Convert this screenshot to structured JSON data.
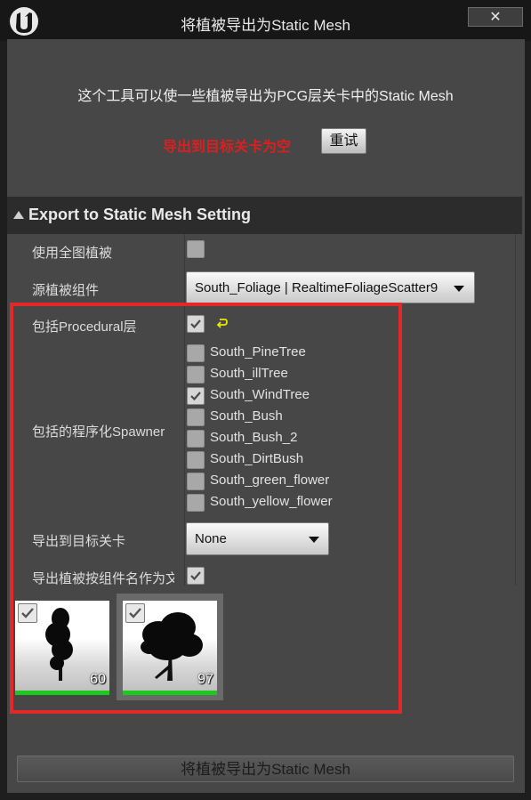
{
  "window": {
    "title": "将植被导出为Static Mesh",
    "close_label": "✕"
  },
  "intro_text": "这个工具可以使一些植被导出为PCG层关卡中的Static Mesh",
  "status_text": "导出到目标关卡为空",
  "retry_label": "重试",
  "section": {
    "title": "Export to Static Mesh Setting"
  },
  "fields": {
    "use_all_foliage": {
      "label": "使用全图植被",
      "checked": false
    },
    "source_component": {
      "label": "源植被组件",
      "value": "South_Foliage | RealtimeFoliageScatter9"
    },
    "include_procedural": {
      "label": "包括Procedural层",
      "checked": true
    },
    "spawners": {
      "label": "包括的程序化Spawner",
      "items": [
        {
          "name": "South_PineTree",
          "checked": false
        },
        {
          "name": "South_illTree",
          "checked": false
        },
        {
          "name": "South_WindTree",
          "checked": true
        },
        {
          "name": "South_Bush",
          "checked": false
        },
        {
          "name": "South_Bush_2",
          "checked": false
        },
        {
          "name": "South_DirtBush",
          "checked": false
        },
        {
          "name": "South_green_flower",
          "checked": false
        },
        {
          "name": "South_yellow_flower",
          "checked": false
        }
      ]
    },
    "target_level": {
      "label": "导出到目标关卡",
      "value": "None"
    },
    "export_by_component_name": {
      "label": "导出植被按组件名作为文件夹",
      "checked": true
    }
  },
  "thumbnails": [
    {
      "count": "60",
      "checked": true,
      "icon": "tall-tree-icon"
    },
    {
      "count": "97",
      "checked": true,
      "icon": "wide-tree-icon"
    }
  ],
  "export_button_label": "将植被导出为Static Mesh",
  "colors": {
    "panel_bg": "#474747",
    "title_bg": "#171717",
    "status_red": "#d92020",
    "highlight_red": "#e32828",
    "thumb_bar_green": "#1ec81e"
  }
}
